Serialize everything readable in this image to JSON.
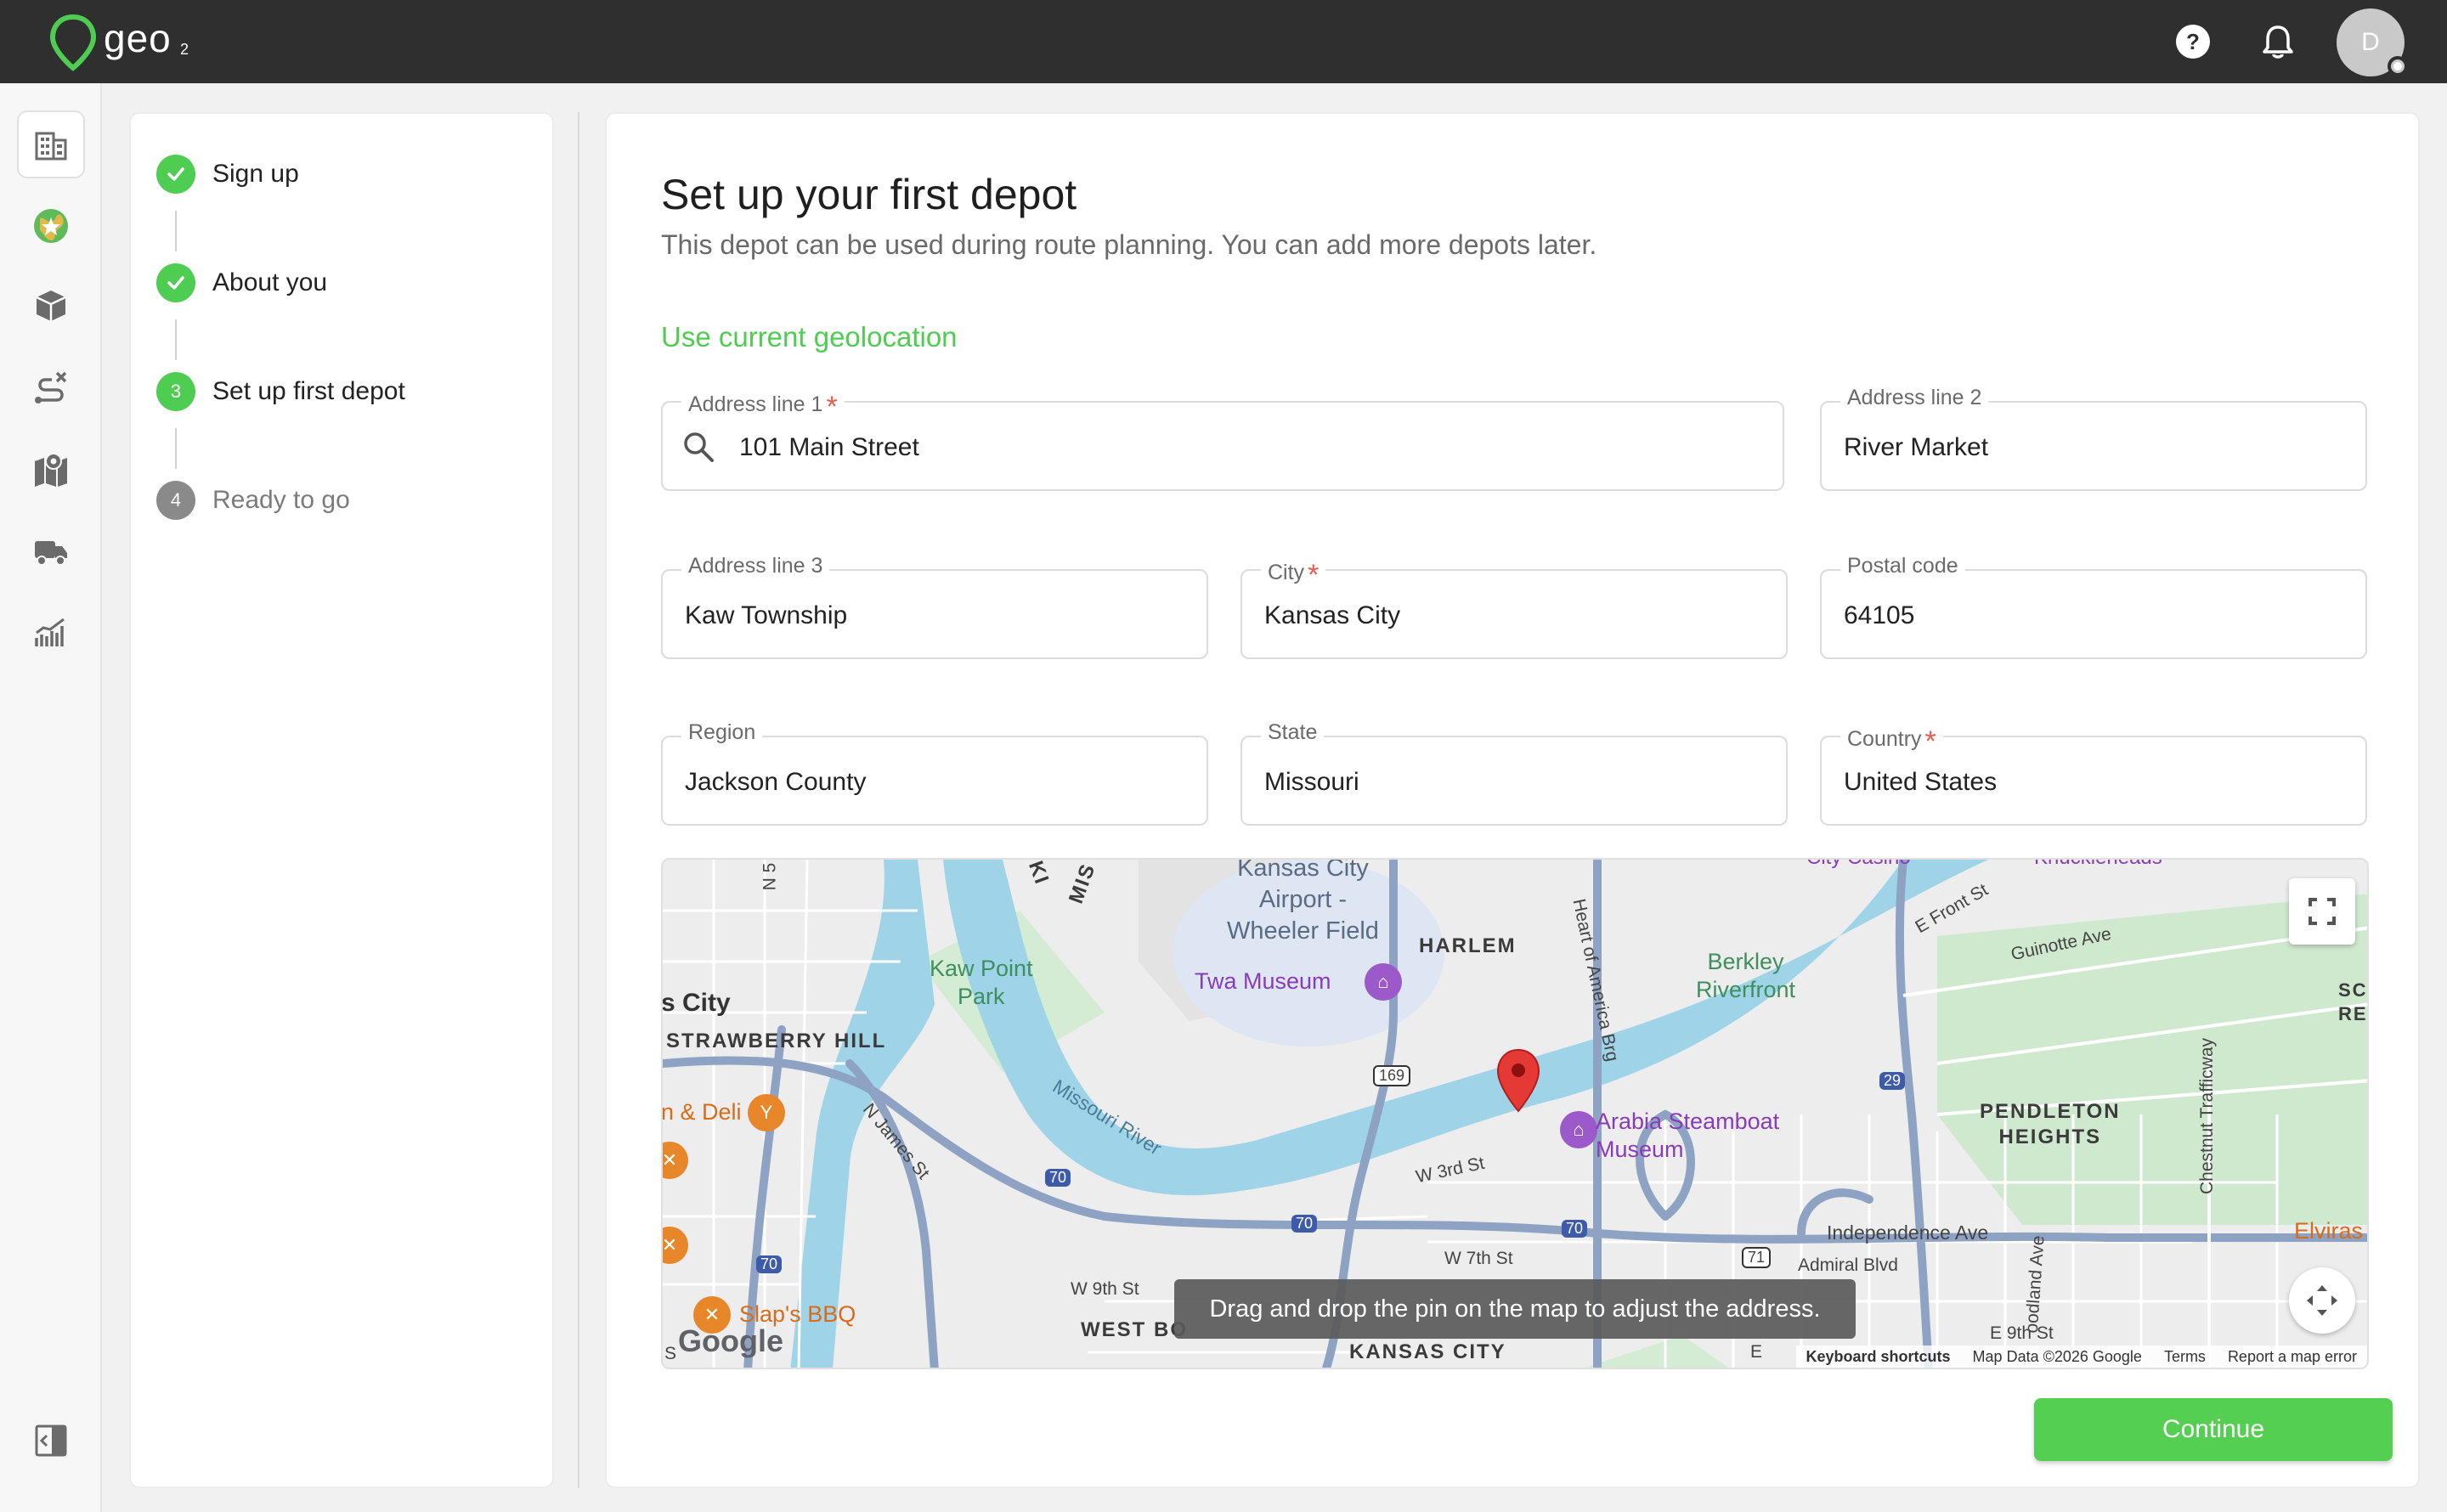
{
  "app": {
    "logo_text": "geo",
    "logo_sub": "2",
    "avatar_initial": "D"
  },
  "topbar": {
    "help_icon": "help-circle-icon",
    "bell_icon": "bell-icon"
  },
  "rail": {
    "items": [
      {
        "icon": "building-icon",
        "active": true
      },
      {
        "icon": "globe-icon"
      },
      {
        "icon": "box-icon"
      },
      {
        "icon": "route-icon"
      },
      {
        "icon": "map-pin-icon"
      },
      {
        "icon": "truck-icon"
      },
      {
        "icon": "analytics-icon"
      }
    ],
    "collapse_icon": "sidebar-collapse-icon"
  },
  "stepper": {
    "steps": [
      {
        "label": "Sign up",
        "state": "done"
      },
      {
        "label": "About you",
        "state": "done"
      },
      {
        "number": "3",
        "label": "Set up first depot",
        "state": "current"
      },
      {
        "number": "4",
        "label": "Ready to go",
        "state": "pending"
      }
    ]
  },
  "form": {
    "title": "Set up your first depot",
    "subtitle": "This depot can be used during route planning. You can add more depots later.",
    "geolocation_link": "Use current geolocation",
    "fields": {
      "address1": {
        "label": "Address line 1",
        "value": "101 Main Street",
        "required": true
      },
      "address2": {
        "label": "Address line 2",
        "value": "River Market"
      },
      "address3": {
        "label": "Address line 3",
        "value": "Kaw Township"
      },
      "city": {
        "label": "City",
        "value": "Kansas City",
        "required": true
      },
      "postal": {
        "label": "Postal code",
        "value": "64105"
      },
      "region": {
        "label": "Region",
        "value": "Jackson County"
      },
      "state": {
        "label": "State",
        "value": "Missouri"
      },
      "country": {
        "label": "Country",
        "value": "United States",
        "required": true
      }
    },
    "required_mark": "*",
    "continue_label": "Continue"
  },
  "map": {
    "tooltip": "Drag and drop the pin on the map to adjust the address.",
    "google": "Google",
    "footer": {
      "shortcuts": "Keyboard shortcuts",
      "data": "Map Data ©2026 Google",
      "terms": "Terms",
      "report": "Report a map error"
    },
    "labels": {
      "airport": "Kansas City\nAirport -\nWheeler Field",
      "harlem": "HARLEM",
      "kaw_point": "Kaw Point\nPark",
      "twa": "Twa Museum",
      "berkley": "Berkley\nRiverfront",
      "city_cut": "s City",
      "strawberry": "STRAWBERRY HILL",
      "deli": "n & Deli",
      "missouri_river": "Missouri River",
      "james": "N James St",
      "arabia": "Arabia Steamboat\nMuseum",
      "w3rd": "W 3rd St",
      "pendleton": "PENDLETON\nHEIGHTS",
      "independence": "Independence Ave",
      "admiral": "Admiral Blvd",
      "elviras": "Elviras",
      "w7th": "W 7th St",
      "w9th": "W 9th St",
      "west_bo": "WEST BO",
      "kansas_city": "KANSAS CITY",
      "slaps": "Slap's BBQ",
      "e9th": "E 9th St",
      "guinotte": "Guinotte Ave",
      "efront": "E Front St",
      "heart": "Heart of America Brg",
      "chestnut": "Chestnut Trafficway",
      "woodland": "oodland Ave",
      "sc": "SC\nRENA",
      "n5": "N 5",
      "ki": "KI",
      "mis": "MIS",
      "e_cut": "E",
      "city_cut_top": "City Casino",
      "knuckleheads": "Knuckleheads",
      "s_cut": "S",
      "r169": "169",
      "r70a": "70",
      "r70b": "70",
      "r70c": "70",
      "r70d": "70",
      "r29": "29",
      "r71": "71"
    }
  }
}
